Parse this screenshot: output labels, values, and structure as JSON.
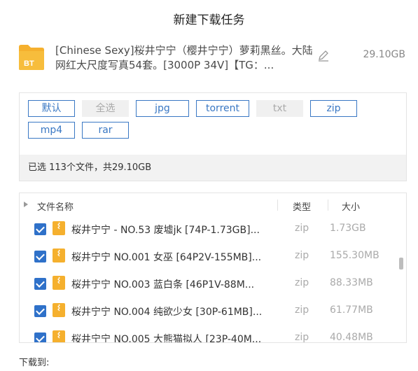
{
  "dialog": {
    "title": "新建下载任务"
  },
  "task": {
    "icon_label": "BT",
    "name": "[Chinese Sexy]桜井宁宁（樱井宁宁）萝莉黑丝。大陆网红大尺度写真54套。[3000P 34V]【TG：...",
    "size": "29.10GB"
  },
  "filters": [
    {
      "label": "默认",
      "active": true
    },
    {
      "label": "全选",
      "active": false
    },
    {
      "label": "jpg",
      "active": true
    },
    {
      "label": "torrent",
      "active": true
    },
    {
      "label": "txt",
      "active": false
    },
    {
      "label": "zip",
      "active": true
    },
    {
      "label": "mp4",
      "active": true
    },
    {
      "label": "rar",
      "active": true
    }
  ],
  "summary": "已选 113个文件，共29.10GB",
  "file_table": {
    "headers": {
      "name": "文件名称",
      "type": "类型",
      "size": "大小"
    },
    "rows": [
      {
        "name": "桜井宁宁 - NO.53 废墟jk [74P-1.73GB]...",
        "type": "zip",
        "size": "1.73GB",
        "checked": true
      },
      {
        "name": "桜井宁宁 NO.001 女巫 [64P2V-155MB]...",
        "type": "zip",
        "size": "155.30MB",
        "checked": true
      },
      {
        "name": "桜井宁宁 NO.003 蓝白条 [46P1V-88M...",
        "type": "zip",
        "size": "88.33MB",
        "checked": true
      },
      {
        "name": "桜井宁宁 NO.004 纯欲少女 [30P-61MB]...",
        "type": "zip",
        "size": "61.77MB",
        "checked": true
      },
      {
        "name": "桜井宁宁 NO.005 大熊猫拟人 [23P-40M...",
        "type": "zip",
        "size": "40.48MB",
        "checked": true
      }
    ]
  },
  "destination": {
    "label": "下载到:"
  },
  "colors": {
    "accent": "#3a78c4",
    "checkbox": "#2f71c9",
    "folder": "#f5b02e"
  }
}
